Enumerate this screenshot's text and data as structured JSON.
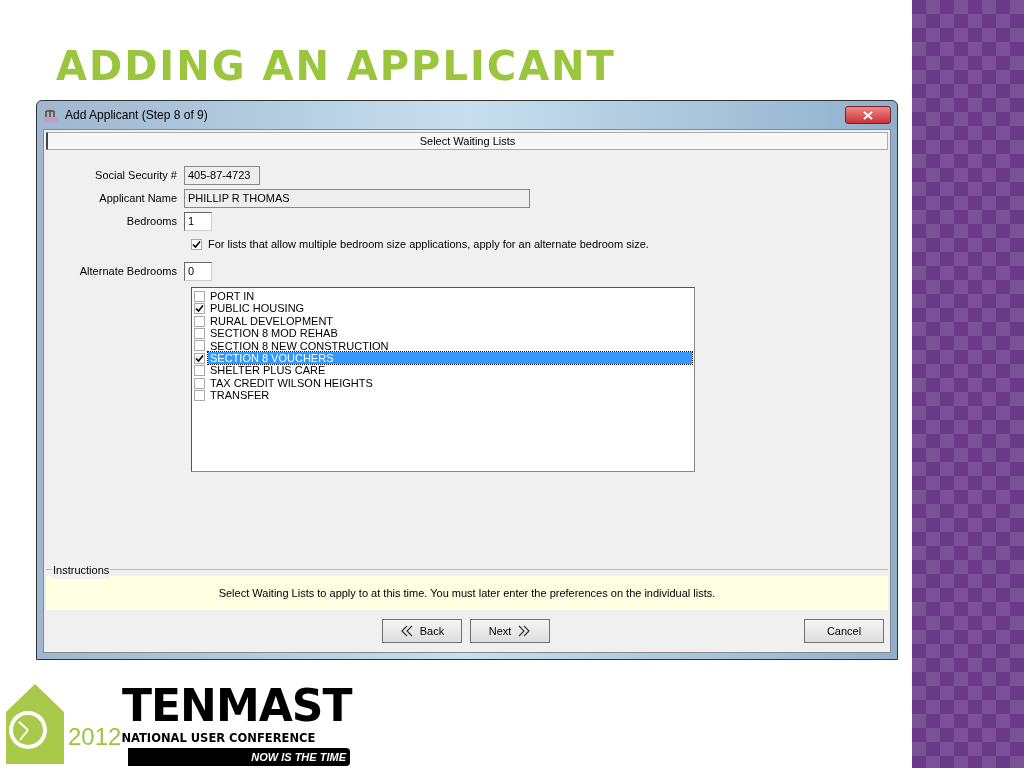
{
  "slide": {
    "title": "ADDING AN APPLICANT"
  },
  "window": {
    "title": "Add Applicant (Step 8 of 9)"
  },
  "header": "Select Waiting Lists",
  "fields": [
    {
      "label": "Social Security #",
      "value": "405-87-4723",
      "kind": "readonly-short"
    },
    {
      "label": "Applicant Name",
      "value": "PHILLIP R THOMAS",
      "kind": "readonly-long"
    },
    {
      "label": "Bedrooms",
      "value": "1",
      "kind": "input"
    }
  ],
  "alternate_option": {
    "label": "For lists that allow multiple bedroom size applications, apply for an alternate bedroom size.",
    "checked": true
  },
  "alternate_field": {
    "label": "Alternate Bedrooms",
    "value": "0"
  },
  "waiting_lists": [
    {
      "label": "PORT IN",
      "checked": false,
      "selected": false
    },
    {
      "label": "PUBLIC HOUSING",
      "checked": true,
      "selected": false
    },
    {
      "label": "RURAL DEVELOPMENT",
      "checked": false,
      "selected": false
    },
    {
      "label": "SECTION 8 MOD REHAB",
      "checked": false,
      "selected": false
    },
    {
      "label": "SECTION 8 NEW CONSTRUCTION",
      "checked": false,
      "selected": false
    },
    {
      "label": "SECTION 8 VOUCHERS",
      "checked": true,
      "selected": true
    },
    {
      "label": "SHELTER PLUS CARE",
      "checked": false,
      "selected": false
    },
    {
      "label": "TAX CREDIT WILSON HEIGHTS",
      "checked": false,
      "selected": false
    },
    {
      "label": "TRANSFER",
      "checked": false,
      "selected": false
    }
  ],
  "instructions": {
    "legend": "Instructions",
    "text": "Select Waiting Lists to apply to at this time.  You must later enter the preferences on the individual lists."
  },
  "buttons": [
    {
      "label": "Back",
      "kind": "back"
    },
    {
      "label": "Next",
      "kind": "next"
    },
    {
      "label": "Cancel",
      "kind": "plain"
    }
  ],
  "logo": {
    "name": "TENMAST",
    "year": "2012",
    "event": "NATIONAL USER CONFERENCE",
    "tagline": "NOW IS THE TIME"
  }
}
